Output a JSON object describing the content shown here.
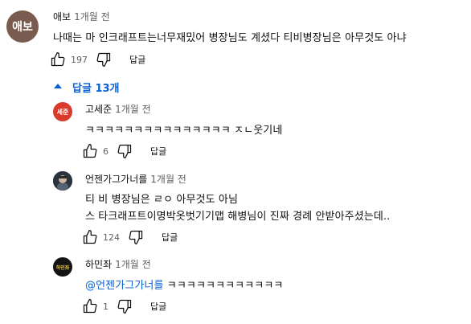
{
  "comment": {
    "avatar_text": "애보",
    "author": "애보",
    "time": "1개월 전",
    "text": "나때는 마 인크래프트는너무재밌어 병장님도 계셨다 티비병장님은 아무것도 아냐",
    "likes": "197",
    "reply_label": "답글"
  },
  "replies_toggle": {
    "label": "답글 13개"
  },
  "replies": [
    {
      "avatar_text": "세준",
      "author": "고세준",
      "time": "1개월 전",
      "lines": [
        "ㅋㅋㅋㅋㅋㅋㅋㅋㅋㅋㅋㅋㅋㅋㅋ ㅈㄴ웃기네"
      ],
      "likes": "6",
      "reply_label": "답글"
    },
    {
      "author": "언젠가그가너를",
      "time": "1개월 전",
      "lines": [
        "티 비 병장님은 ㄹㅇ 아무것도 아님",
        "스 타크래프트이명박옷벗기기맵 해병님이 진짜 경례 안받아주셨는데.."
      ],
      "likes": "124",
      "reply_label": "답글"
    },
    {
      "avatar_text": "하민좌",
      "author": "하민좌",
      "time": "1개월 전",
      "mention": "@언젠가그가너를",
      "text_after_mention": " ㅋㅋㅋㅋㅋㅋㅋㅋㅋㅋㅋㅋ",
      "likes": "1",
      "reply_label": "답글"
    }
  ],
  "colors": {
    "link_blue": "#065fd4",
    "meta_gray": "#606060",
    "avatar_main": "#7a5b4f",
    "avatar_reply1": "#d93a2b",
    "avatar_reply3": "#141414"
  },
  "icons": [
    "thumbs-up-icon",
    "thumbs-down-icon",
    "caret-up-icon"
  ]
}
